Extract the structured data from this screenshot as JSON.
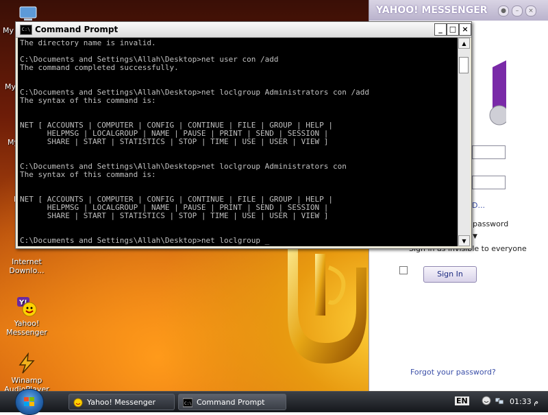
{
  "desktop": {
    "icons": [
      {
        "label": "Internet\nDownlo..."
      },
      {
        "label": "Yahoo!\nMessenger"
      },
      {
        "label": "Winamp\nAudioPlayer"
      }
    ],
    "edge_labels": [
      "My",
      "My",
      "My",
      "E"
    ]
  },
  "cmd": {
    "title": "Command Prompt",
    "icon_text": "C:\\",
    "lines": [
      "The directory name is invalid.",
      "",
      "C:\\Documents and Settings\\Allah\\Desktop>net user con /add",
      "The command completed successfully.",
      "",
      "",
      "C:\\Documents and Settings\\Allah\\Desktop>net loclgroup Administrators con /add",
      "The syntax of this command is:",
      "",
      "",
      "NET [ ACCOUNTS | COMPUTER | CONFIG | CONTINUE | FILE | GROUP | HELP |",
      "      HELPMSG | LOCALGROUP | NAME | PAUSE | PRINT | SEND | SESSION |",
      "      SHARE | START | STATISTICS | STOP | TIME | USE | USER | VIEW ]",
      "",
      "",
      "C:\\Documents and Settings\\Allah\\Desktop>net loclgroup Administrators con",
      "The syntax of this command is:",
      "",
      "",
      "NET [ ACCOUNTS | COMPUTER | CONFIG | CONTINUE | FILE | GROUP | HELP |",
      "      HELPMSG | LOCALGROUP | NAME | PAUSE | PRINT | SEND | SESSION |",
      "      SHARE | START | STATISTICS | STOP | TIME | USE | USER | VIEW ]",
      "",
      "",
      "C:\\Documents and Settings\\Allah\\Desktop>net loclgroup _"
    ]
  },
  "ym": {
    "title": "YAHOO! MESSENGER",
    "link_partial": "D...",
    "remember_password": "password",
    "invisible": "Sign in as invisible to everyone",
    "signin_label": "Sign In",
    "forgot": "Forgot your password?"
  },
  "taskbar": {
    "tasks": [
      {
        "label": "Yahoo! Messenger"
      },
      {
        "label": "Command Prompt"
      }
    ],
    "lang": "EN",
    "clock": "01:33 م"
  }
}
